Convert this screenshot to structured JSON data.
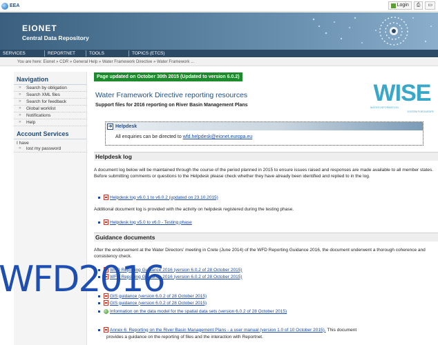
{
  "topbar": {
    "logo_text": "EEA",
    "login_label": "Login"
  },
  "header": {
    "site_name": "EIONET",
    "site_subtitle": "Central Data Repository"
  },
  "menu": [
    "SERVICES",
    "REPORTNET",
    "TOOLS",
    "TOPICS (ETCS)"
  ],
  "breadcrumb": "You are here: Eionet » CDR » General Help » Water Framework Directive » Water Framework ...",
  "sidebar": {
    "nav_heading": "Navigation",
    "nav_items": [
      "Search by obligation",
      "Search XML files",
      "Search for feedback",
      "Global worklist",
      "Notifications",
      "Help"
    ],
    "account_heading": "Account Services",
    "account_text": "I have",
    "account_items": [
      "lost my password"
    ]
  },
  "main": {
    "banner": "Page updated on October 30th 2015 (Updated to version 6.0.2)",
    "title": "Water Framework Directive reporting resources",
    "subtitle": "Support files for 2016 reporting on River Basin Management Plans",
    "wise": {
      "text": "WISE",
      "tag": "WATER INFORMATION",
      "tag2": "SYSTEM FOR EUROPE"
    },
    "helpdesk": {
      "label": "Helpdesk",
      "line_prefix": "All enquiries can be directed to ",
      "email": "wfd.helpdesk@eionet.europa.eu"
    },
    "helpdesk_log": {
      "heading": "Helpdesk log",
      "paragraph": "A document log below will be maintained through the course of the period planned in 2015 to ensure issues raised and responses are made available to all member states. Before submitting comments or questions to the Helpdesk please check whether they have already been identified and replied to in the log.",
      "item1": "Helpdesk log v6.0.1 to v6.0.2 (updated on 23.10.2015)",
      "paragraph2": "Additional document log is provided with the activity on helpdesk registered during the testing phase.",
      "item2": "Helpdesk log v5.0 to v6.0 - Testing phase"
    },
    "guidance": {
      "heading": "Guidance documents",
      "paragraph": "After the endorsement at the Water Directors' meeting in Crete (June 2014) of the WFD Reporting Guidance 2016, the document underwent a thorough coherence and consistency check.",
      "items": [
        "WFD Reporting Guidance 2016 (version 6.0.2 of 28 October 2015)",
        "WFD Reporting Guidance 2016 (version 6.0.2 of 28 October 2015)",
        "GIS guidance (version 6.0.2 of 28 October 2015)",
        "GIS guidance (version 6.0.2 of 28 October 2015)",
        "Information on the data model for the spatial data sets (version 6.0.2 of 28 October 2015)"
      ],
      "annex_link": "Annex 6: Reporting on the River Basin Management Plans - a user manual (version 1.0 of 10 October 2015).",
      "annex_rest": " This document",
      "annex_line2": "provides a guidance on the reporting of files and the interaction with Reportnet."
    },
    "watermark": "WFD2016"
  },
  "colors": {
    "banner_green": "#1d8a2c",
    "link_blue": "#1a49a8",
    "header_blue": "#3b607f"
  }
}
